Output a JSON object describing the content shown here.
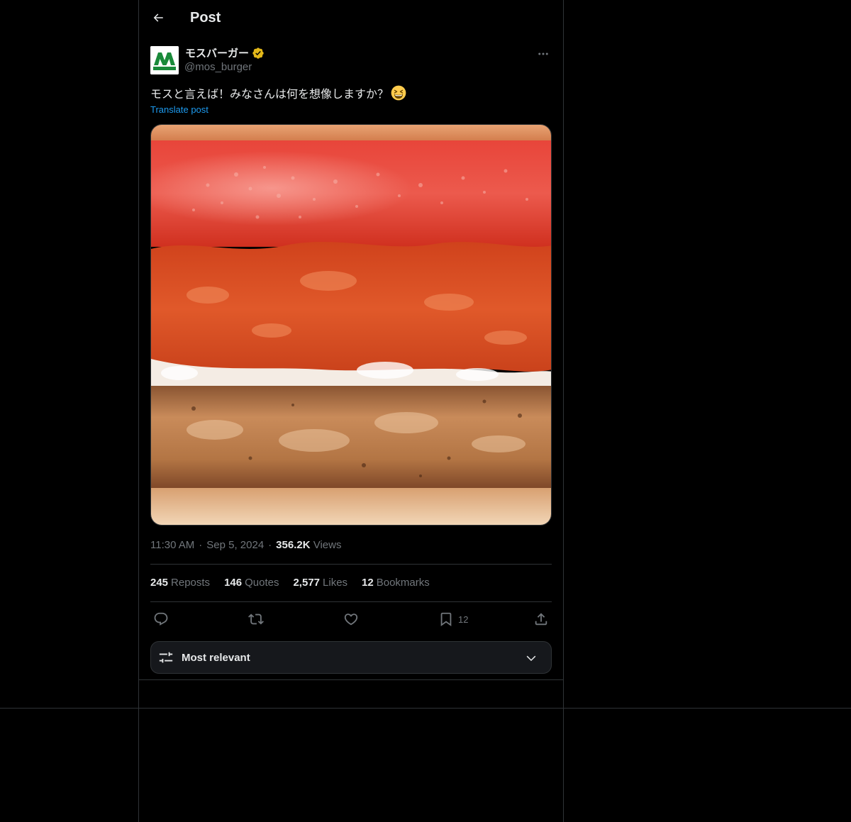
{
  "header": {
    "title": "Post"
  },
  "author": {
    "name": "モスバーガー",
    "handle": "@mos_burger",
    "avatar_text": "MOS BURGER",
    "verified": true,
    "verified_color": "#e2b719"
  },
  "post": {
    "text": "モスと言えば！みなさんは何を想像しますか？",
    "emoji": "grinning-squinting-face",
    "translate_label": "Translate post"
  },
  "meta": {
    "time": "11:30 AM",
    "date": "Sep 5, 2024",
    "separator": "·",
    "views_count": "356.2K",
    "views_label": "Views"
  },
  "stats": [
    {
      "count": "245",
      "label": "Reposts"
    },
    {
      "count": "146",
      "label": "Quotes"
    },
    {
      "count": "2,577",
      "label": "Likes"
    },
    {
      "count": "12",
      "label": "Bookmarks"
    }
  ],
  "actions": {
    "reply_icon": "reply-icon",
    "repost_icon": "repost-icon",
    "like_icon": "heart-icon",
    "bookmark_icon": "bookmark-icon",
    "bookmark_count": "12",
    "share_icon": "share-icon"
  },
  "sort": {
    "label": "Most relevant"
  },
  "colors": {
    "background": "#000000",
    "text": "#e7e9ea",
    "muted": "#71767b",
    "accent": "#1d9bf0",
    "border": "#2f3336",
    "brand_green": "#1a8a3a"
  }
}
